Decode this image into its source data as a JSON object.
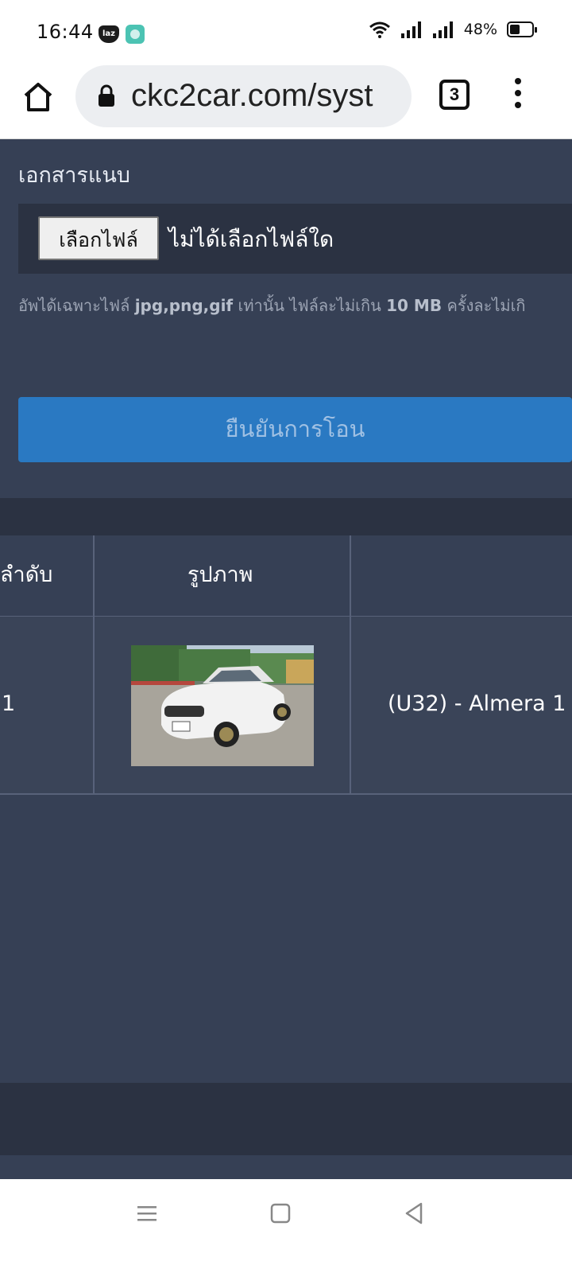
{
  "status_bar": {
    "time": "16:44",
    "battery": "48%",
    "laz_badge": "laz"
  },
  "browser": {
    "url": "ckc2car.com/syst",
    "tab_count": "3"
  },
  "form": {
    "attachment_label": "เอกสารแนบ",
    "choose_file_button": "เลือกไฟล์",
    "no_file_text": "ไม่ได้เลือกไฟล์ใด",
    "hint_prefix": "อัพได้เฉพาะไฟล์ ",
    "hint_types": "jpg,png,gif",
    "hint_middle": " เท่านั้น ไฟล์ละไม่เกิน ",
    "hint_size": "10 MB",
    "hint_suffix": " ครั้งละไม่เกิ",
    "confirm_button": "ยืนยันการโอน"
  },
  "table": {
    "headers": [
      "ลำดับ",
      "รูปภาพ",
      ""
    ],
    "rows": [
      {
        "index": "1",
        "model": "(U32) - Almera 1"
      }
    ]
  },
  "icons": {
    "home": "home-icon",
    "lock": "lock-icon",
    "tabs": "tabs-icon",
    "menu": "more-vert-icon",
    "wifi": "wifi-icon",
    "signal": "signal-icon",
    "battery": "battery-icon",
    "nav_recents": "recents-icon",
    "nav_home": "nav-home-icon",
    "nav_back": "back-icon"
  },
  "colors": {
    "page_bg": "#364055",
    "band_bg": "#2b3242",
    "confirm_bg": "#2a79c2"
  }
}
